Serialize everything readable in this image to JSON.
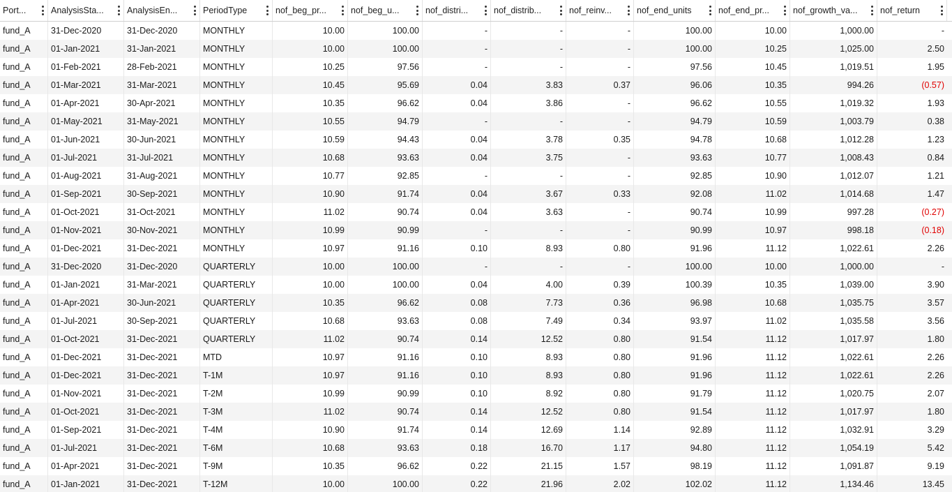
{
  "columns": [
    {
      "key": "portfolio",
      "label": "Port...",
      "align": "left"
    },
    {
      "key": "start",
      "label": "AnalysisSta...",
      "align": "left"
    },
    {
      "key": "end",
      "label": "AnalysisEn...",
      "align": "left"
    },
    {
      "key": "period",
      "label": "PeriodType",
      "align": "left"
    },
    {
      "key": "beg_price",
      "label": "nof_beg_pr...",
      "align": "right"
    },
    {
      "key": "beg_units",
      "label": "nof_beg_u...",
      "align": "right"
    },
    {
      "key": "distri",
      "label": "nof_distri...",
      "align": "right"
    },
    {
      "key": "distrib",
      "label": "nof_distrib...",
      "align": "right"
    },
    {
      "key": "reinv",
      "label": "nof_reinv...",
      "align": "right"
    },
    {
      "key": "end_units",
      "label": "nof_end_units",
      "align": "right"
    },
    {
      "key": "end_price",
      "label": "nof_end_pr...",
      "align": "right"
    },
    {
      "key": "growth",
      "label": "nof_growth_va...",
      "align": "right"
    },
    {
      "key": "ret",
      "label": "nof_return",
      "align": "right"
    }
  ],
  "rows": [
    [
      "fund_A",
      "31-Dec-2020",
      "31-Dec-2020",
      "MONTHLY",
      "10.00",
      "100.00",
      "-",
      "-",
      "-",
      "100.00",
      "10.00",
      "1,000.00",
      "-"
    ],
    [
      "fund_A",
      "01-Jan-2021",
      "31-Jan-2021",
      "MONTHLY",
      "10.00",
      "100.00",
      "-",
      "-",
      "-",
      "100.00",
      "10.25",
      "1,025.00",
      "2.50"
    ],
    [
      "fund_A",
      "01-Feb-2021",
      "28-Feb-2021",
      "MONTHLY",
      "10.25",
      "97.56",
      "-",
      "-",
      "-",
      "97.56",
      "10.45",
      "1,019.51",
      "1.95"
    ],
    [
      "fund_A",
      "01-Mar-2021",
      "31-Mar-2021",
      "MONTHLY",
      "10.45",
      "95.69",
      "0.04",
      "3.83",
      "0.37",
      "96.06",
      "10.35",
      "994.26",
      "(0.57)"
    ],
    [
      "fund_A",
      "01-Apr-2021",
      "30-Apr-2021",
      "MONTHLY",
      "10.35",
      "96.62",
      "0.04",
      "3.86",
      "-",
      "96.62",
      "10.55",
      "1,019.32",
      "1.93"
    ],
    [
      "fund_A",
      "01-May-2021",
      "31-May-2021",
      "MONTHLY",
      "10.55",
      "94.79",
      "-",
      "-",
      "-",
      "94.79",
      "10.59",
      "1,003.79",
      "0.38"
    ],
    [
      "fund_A",
      "01-Jun-2021",
      "30-Jun-2021",
      "MONTHLY",
      "10.59",
      "94.43",
      "0.04",
      "3.78",
      "0.35",
      "94.78",
      "10.68",
      "1,012.28",
      "1.23"
    ],
    [
      "fund_A",
      "01-Jul-2021",
      "31-Jul-2021",
      "MONTHLY",
      "10.68",
      "93.63",
      "0.04",
      "3.75",
      "-",
      "93.63",
      "10.77",
      "1,008.43",
      "0.84"
    ],
    [
      "fund_A",
      "01-Aug-2021",
      "31-Aug-2021",
      "MONTHLY",
      "10.77",
      "92.85",
      "-",
      "-",
      "-",
      "92.85",
      "10.90",
      "1,012.07",
      "1.21"
    ],
    [
      "fund_A",
      "01-Sep-2021",
      "30-Sep-2021",
      "MONTHLY",
      "10.90",
      "91.74",
      "0.04",
      "3.67",
      "0.33",
      "92.08",
      "11.02",
      "1,014.68",
      "1.47"
    ],
    [
      "fund_A",
      "01-Oct-2021",
      "31-Oct-2021",
      "MONTHLY",
      "11.02",
      "90.74",
      "0.04",
      "3.63",
      "-",
      "90.74",
      "10.99",
      "997.28",
      "(0.27)"
    ],
    [
      "fund_A",
      "01-Nov-2021",
      "30-Nov-2021",
      "MONTHLY",
      "10.99",
      "90.99",
      "-",
      "-",
      "-",
      "90.99",
      "10.97",
      "998.18",
      "(0.18)"
    ],
    [
      "fund_A",
      "01-Dec-2021",
      "31-Dec-2021",
      "MONTHLY",
      "10.97",
      "91.16",
      "0.10",
      "8.93",
      "0.80",
      "91.96",
      "11.12",
      "1,022.61",
      "2.26"
    ],
    [
      "fund_A",
      "31-Dec-2020",
      "31-Dec-2020",
      "QUARTERLY",
      "10.00",
      "100.00",
      "-",
      "-",
      "-",
      "100.00",
      "10.00",
      "1,000.00",
      "-"
    ],
    [
      "fund_A",
      "01-Jan-2021",
      "31-Mar-2021",
      "QUARTERLY",
      "10.00",
      "100.00",
      "0.04",
      "4.00",
      "0.39",
      "100.39",
      "10.35",
      "1,039.00",
      "3.90"
    ],
    [
      "fund_A",
      "01-Apr-2021",
      "30-Jun-2021",
      "QUARTERLY",
      "10.35",
      "96.62",
      "0.08",
      "7.73",
      "0.36",
      "96.98",
      "10.68",
      "1,035.75",
      "3.57"
    ],
    [
      "fund_A",
      "01-Jul-2021",
      "30-Sep-2021",
      "QUARTERLY",
      "10.68",
      "93.63",
      "0.08",
      "7.49",
      "0.34",
      "93.97",
      "11.02",
      "1,035.58",
      "3.56"
    ],
    [
      "fund_A",
      "01-Oct-2021",
      "31-Dec-2021",
      "QUARTERLY",
      "11.02",
      "90.74",
      "0.14",
      "12.52",
      "0.80",
      "91.54",
      "11.12",
      "1,017.97",
      "1.80"
    ],
    [
      "fund_A",
      "01-Dec-2021",
      "31-Dec-2021",
      "MTD",
      "10.97",
      "91.16",
      "0.10",
      "8.93",
      "0.80",
      "91.96",
      "11.12",
      "1,022.61",
      "2.26"
    ],
    [
      "fund_A",
      "01-Dec-2021",
      "31-Dec-2021",
      "T-1M",
      "10.97",
      "91.16",
      "0.10",
      "8.93",
      "0.80",
      "91.96",
      "11.12",
      "1,022.61",
      "2.26"
    ],
    [
      "fund_A",
      "01-Nov-2021",
      "31-Dec-2021",
      "T-2M",
      "10.99",
      "90.99",
      "0.10",
      "8.92",
      "0.80",
      "91.79",
      "11.12",
      "1,020.75",
      "2.07"
    ],
    [
      "fund_A",
      "01-Oct-2021",
      "31-Dec-2021",
      "T-3M",
      "11.02",
      "90.74",
      "0.14",
      "12.52",
      "0.80",
      "91.54",
      "11.12",
      "1,017.97",
      "1.80"
    ],
    [
      "fund_A",
      "01-Sep-2021",
      "31-Dec-2021",
      "T-4M",
      "10.90",
      "91.74",
      "0.14",
      "12.69",
      "1.14",
      "92.89",
      "11.12",
      "1,032.91",
      "3.29"
    ],
    [
      "fund_A",
      "01-Jul-2021",
      "31-Dec-2021",
      "T-6M",
      "10.68",
      "93.63",
      "0.18",
      "16.70",
      "1.17",
      "94.80",
      "11.12",
      "1,054.19",
      "5.42"
    ],
    [
      "fund_A",
      "01-Apr-2021",
      "31-Dec-2021",
      "T-9M",
      "10.35",
      "96.62",
      "0.22",
      "21.15",
      "1.57",
      "98.19",
      "11.12",
      "1,091.87",
      "9.19"
    ],
    [
      "fund_A",
      "01-Jan-2021",
      "31-Dec-2021",
      "T-12M",
      "10.00",
      "100.00",
      "0.22",
      "21.96",
      "2.02",
      "102.02",
      "11.12",
      "1,134.46",
      "13.45"
    ]
  ],
  "colors": {
    "negative": "#e00000",
    "stripe": "#f4f4f4"
  }
}
